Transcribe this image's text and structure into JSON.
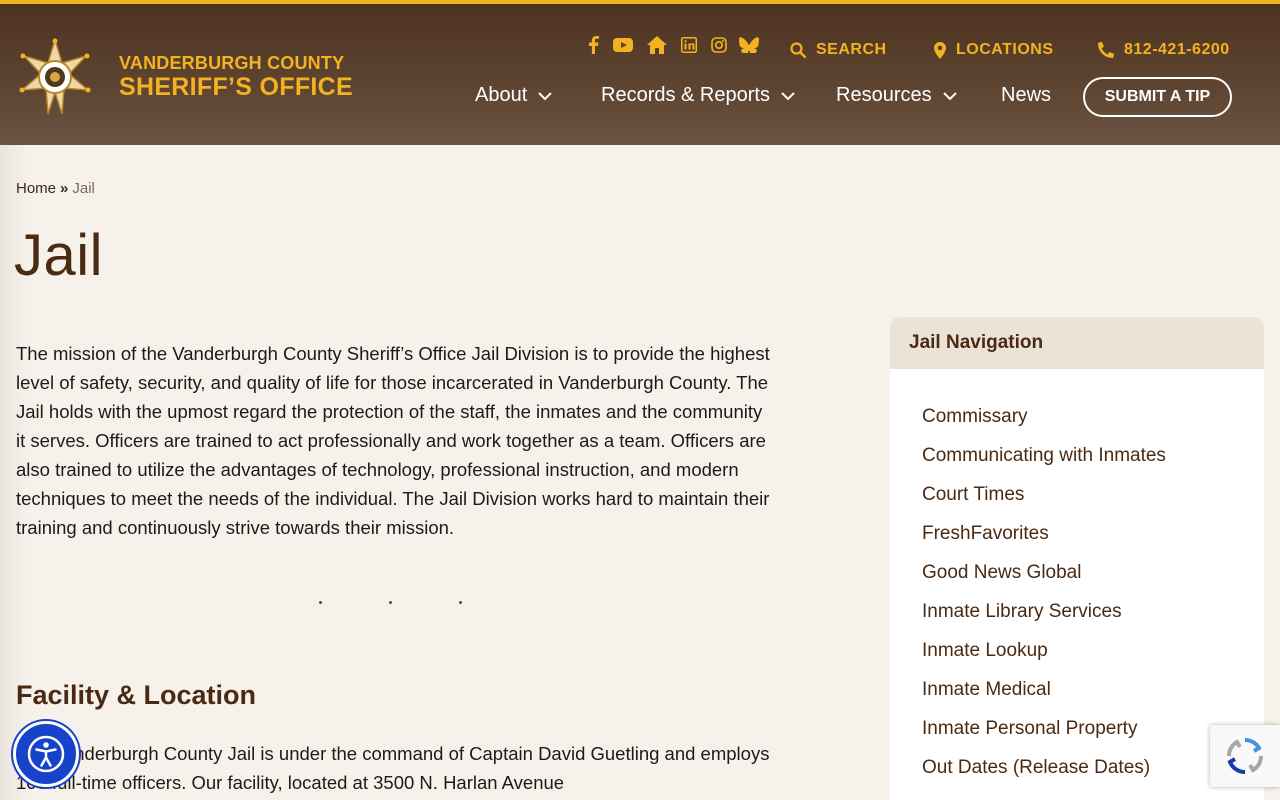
{
  "header": {
    "logo_line1": "VANDERBURGH COUNTY",
    "logo_line2": "SHERIFF’S OFFICE",
    "search_label": "SEARCH",
    "locations_label": "LOCATIONS",
    "phone": "812-421-6200",
    "social_icons": [
      "facebook-icon",
      "youtube-icon",
      "home-icon",
      "linkedin-icon",
      "instagram-icon",
      "bluesky-icon"
    ],
    "nav": {
      "about": "About",
      "records": "Records & Reports",
      "resources": "Resources",
      "news": "News"
    },
    "tip_button": "SUBMIT A TIP"
  },
  "breadcrumb": {
    "home": "Home",
    "separator": "»",
    "current": "Jail"
  },
  "page": {
    "title": "Jail",
    "mission": "The mission of the Vanderburgh County Sheriff’s Office Jail Division is to provide the highest level of safety, security, and quality of life for those incarcerated in Vanderburgh County. The Jail holds with the upmost regard the protection of the staff, the inmates and the community it serves. Officers are trained to act professionally and work together as a team. Officers are also trained to utilize the advantages of technology, professional instruction, and modern techniques to meet the needs of the individual. The Jail Division works hard to maintain their training and continuously strive towards their mission.",
    "section_heading": "Facility & Location",
    "facility_text": "The Vanderburgh County Jail is under the command of Captain David Guetling and employs 103 full-time officers. Our facility, located at 3500 N. Harlan Avenue"
  },
  "sidebar": {
    "title": "Jail Navigation",
    "items": [
      "Commissary",
      "Communicating with Inmates",
      "Court Times",
      "FreshFavorites",
      "Good News Global",
      "Inmate Library Services",
      "Inmate Lookup",
      "Inmate Medical",
      "Inmate Personal Property",
      "Out Dates (Release Dates)"
    ]
  },
  "colors": {
    "accent": "#f3b21f",
    "heading": "#4a2a12",
    "header_bg": "#5e4532",
    "page_bg": "#f6f1ea",
    "a11y_blue": "#1643c9"
  }
}
